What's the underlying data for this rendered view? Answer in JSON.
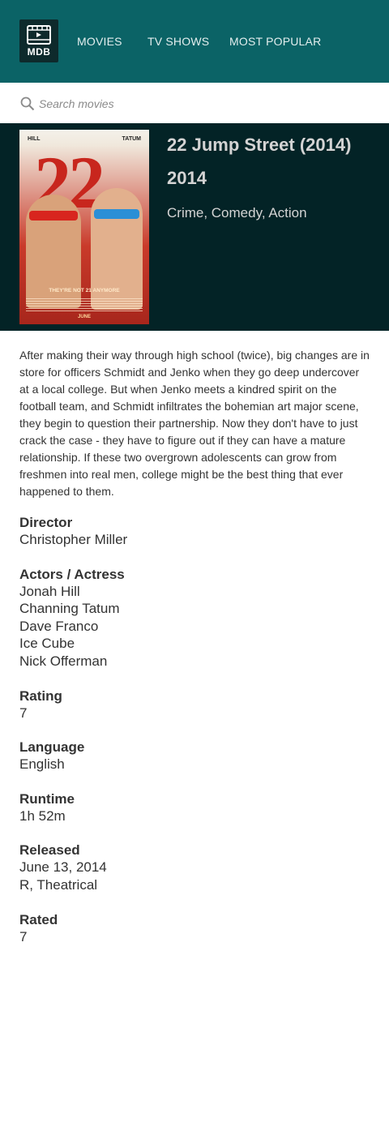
{
  "header": {
    "logo_text": "MDB",
    "nav": [
      "MOVIES",
      "TV SHOWS",
      "MOST POPULAR"
    ]
  },
  "search": {
    "placeholder": "Search movies",
    "value": ""
  },
  "movie": {
    "title": "22 Jump Street (2014)",
    "year": "2014",
    "genres": "Crime, Comedy, Action",
    "poster": {
      "left_name": "HILL",
      "right_name": "TATUM",
      "big_number": "22",
      "tagline": "THEY'RE NOT 21 ANYMORE",
      "release": "JUNE"
    },
    "overview": "After making their way through high school (twice), big changes are in store for officers Schmidt and Jenko when they go deep undercover at a local college. But when Jenko meets a kindred spirit on the football team, and Schmidt infiltrates the bohemian art major scene, they begin to question their partnership. Now they don't have to just crack the case - they have to figure out if they can have a mature relationship. If these two overgrown adolescents can grow from freshmen into real men, college might be the best thing that ever happened to them."
  },
  "details": {
    "director_label": "Director",
    "director": "Christopher Miller",
    "actors_label": "Actors / Actress",
    "actors": [
      "Jonah Hill",
      "Channing Tatum",
      "Dave Franco",
      "Ice Cube",
      "Nick Offerman"
    ],
    "rating_label": "Rating",
    "rating": "7",
    "language_label": "Language",
    "language": "English",
    "runtime_label": "Runtime",
    "runtime": "1h 52m",
    "released_label": "Released",
    "released_date": "June 13, 2014",
    "released_type": "R, Theatrical",
    "rated_label": "Rated",
    "rated": "7"
  },
  "colors": {
    "header_bg": "#0b6366",
    "hero_bg": "#032326",
    "text": "#333333"
  }
}
